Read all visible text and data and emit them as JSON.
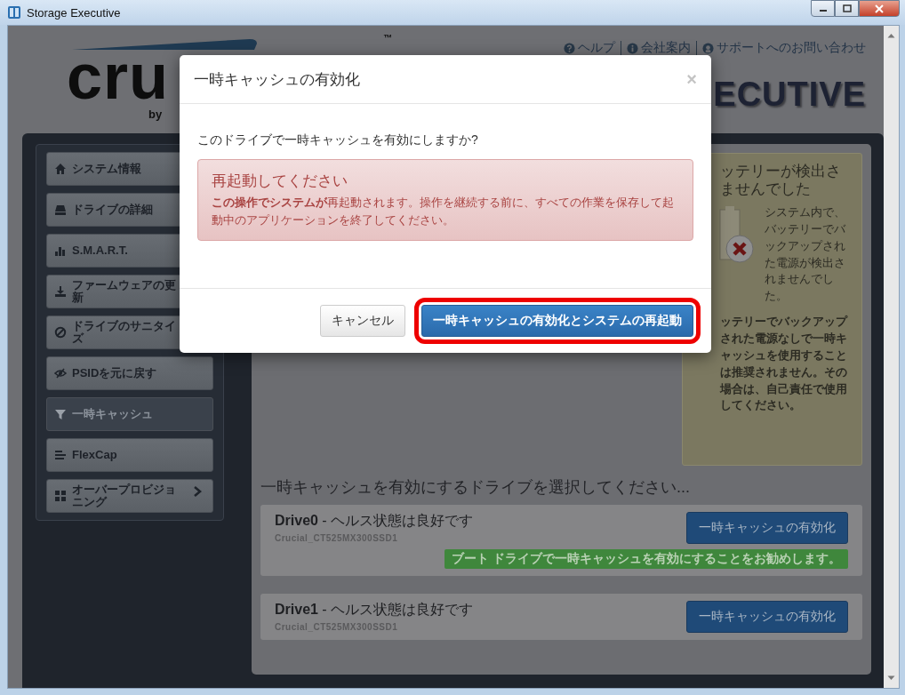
{
  "window": {
    "title": "Storage Executive"
  },
  "header": {
    "logo": {
      "text": "cru",
      "trademark": "™",
      "byline": "by"
    },
    "links": [
      {
        "label": "ヘルプ",
        "kind": "help"
      },
      {
        "label": "会社案内",
        "kind": "info"
      },
      {
        "label": "サポートへのお問い合わせ",
        "kind": "support"
      }
    ],
    "product_title": "ECUTIVE"
  },
  "sidebar": {
    "items": [
      {
        "label": "システム情報",
        "kind": "home",
        "selected": false
      },
      {
        "label": "ドライブの詳細",
        "kind": "drive",
        "selected": false
      },
      {
        "label": "S.M.A.R.T.",
        "kind": "chart",
        "selected": false
      },
      {
        "label": "ファームウェアの更新",
        "kind": "download",
        "selected": false
      },
      {
        "label": "ドライブのサニタイズ",
        "kind": "ban",
        "selected": false
      },
      {
        "label": "PSIDを元に戻す",
        "kind": "eye",
        "selected": false
      },
      {
        "label": "一時キャッシュ",
        "kind": "filter",
        "selected": true
      },
      {
        "label": "FlexCap",
        "kind": "list",
        "selected": false
      },
      {
        "label": "オーバープロビジョニング",
        "kind": "grid",
        "selected": false,
        "expandable": true
      }
    ]
  },
  "battery_notice": {
    "title_lines": [
      "ッテリーが検出さ",
      "ませんでした"
    ],
    "detail": "システム内で、バッテリーでバックアップされた電源が検出されませんでした。",
    "warning": "ッテリーでバックアップされた電源なしで一時キャッシュを使用することは推奨されません。その場合は、自己責任で使用してください。"
  },
  "drive_section": {
    "heading": "一時キャッシュを有効にするドライブを選択してください...",
    "drives": [
      {
        "title": "**Drive0** - ヘルス状態は良好です",
        "model": "Crucial_CT525MX300SSD1",
        "button": "一時キャッシュの有効化",
        "recommendation": "ブート ドライブで一時キャッシュを有効にすることをお勧めします。"
      },
      {
        "title": "**Drive1** - ヘルス状態は良好です",
        "model": "Crucial_CT525MX300SSD1",
        "button": "一時キャッシュの有効化"
      }
    ]
  },
  "dialog": {
    "title": "一時キャッシュの有効化",
    "close": "×",
    "question": "このドライブで一時キャッシュを有効にしますか?",
    "alert": {
      "heading": "再起動してください",
      "message": "**この操作でシステムが**再起動されます。操作を継続する前に、すべての作業を保存して起動中のアプリケーションを終了してください。"
    },
    "buttons": [
      {
        "label": "キャンセル",
        "kind": "default",
        "highlighted": false
      },
      {
        "label": "一時キャッシュの有効化とシステムの再起動",
        "kind": "primary",
        "highlighted": true
      }
    ]
  }
}
